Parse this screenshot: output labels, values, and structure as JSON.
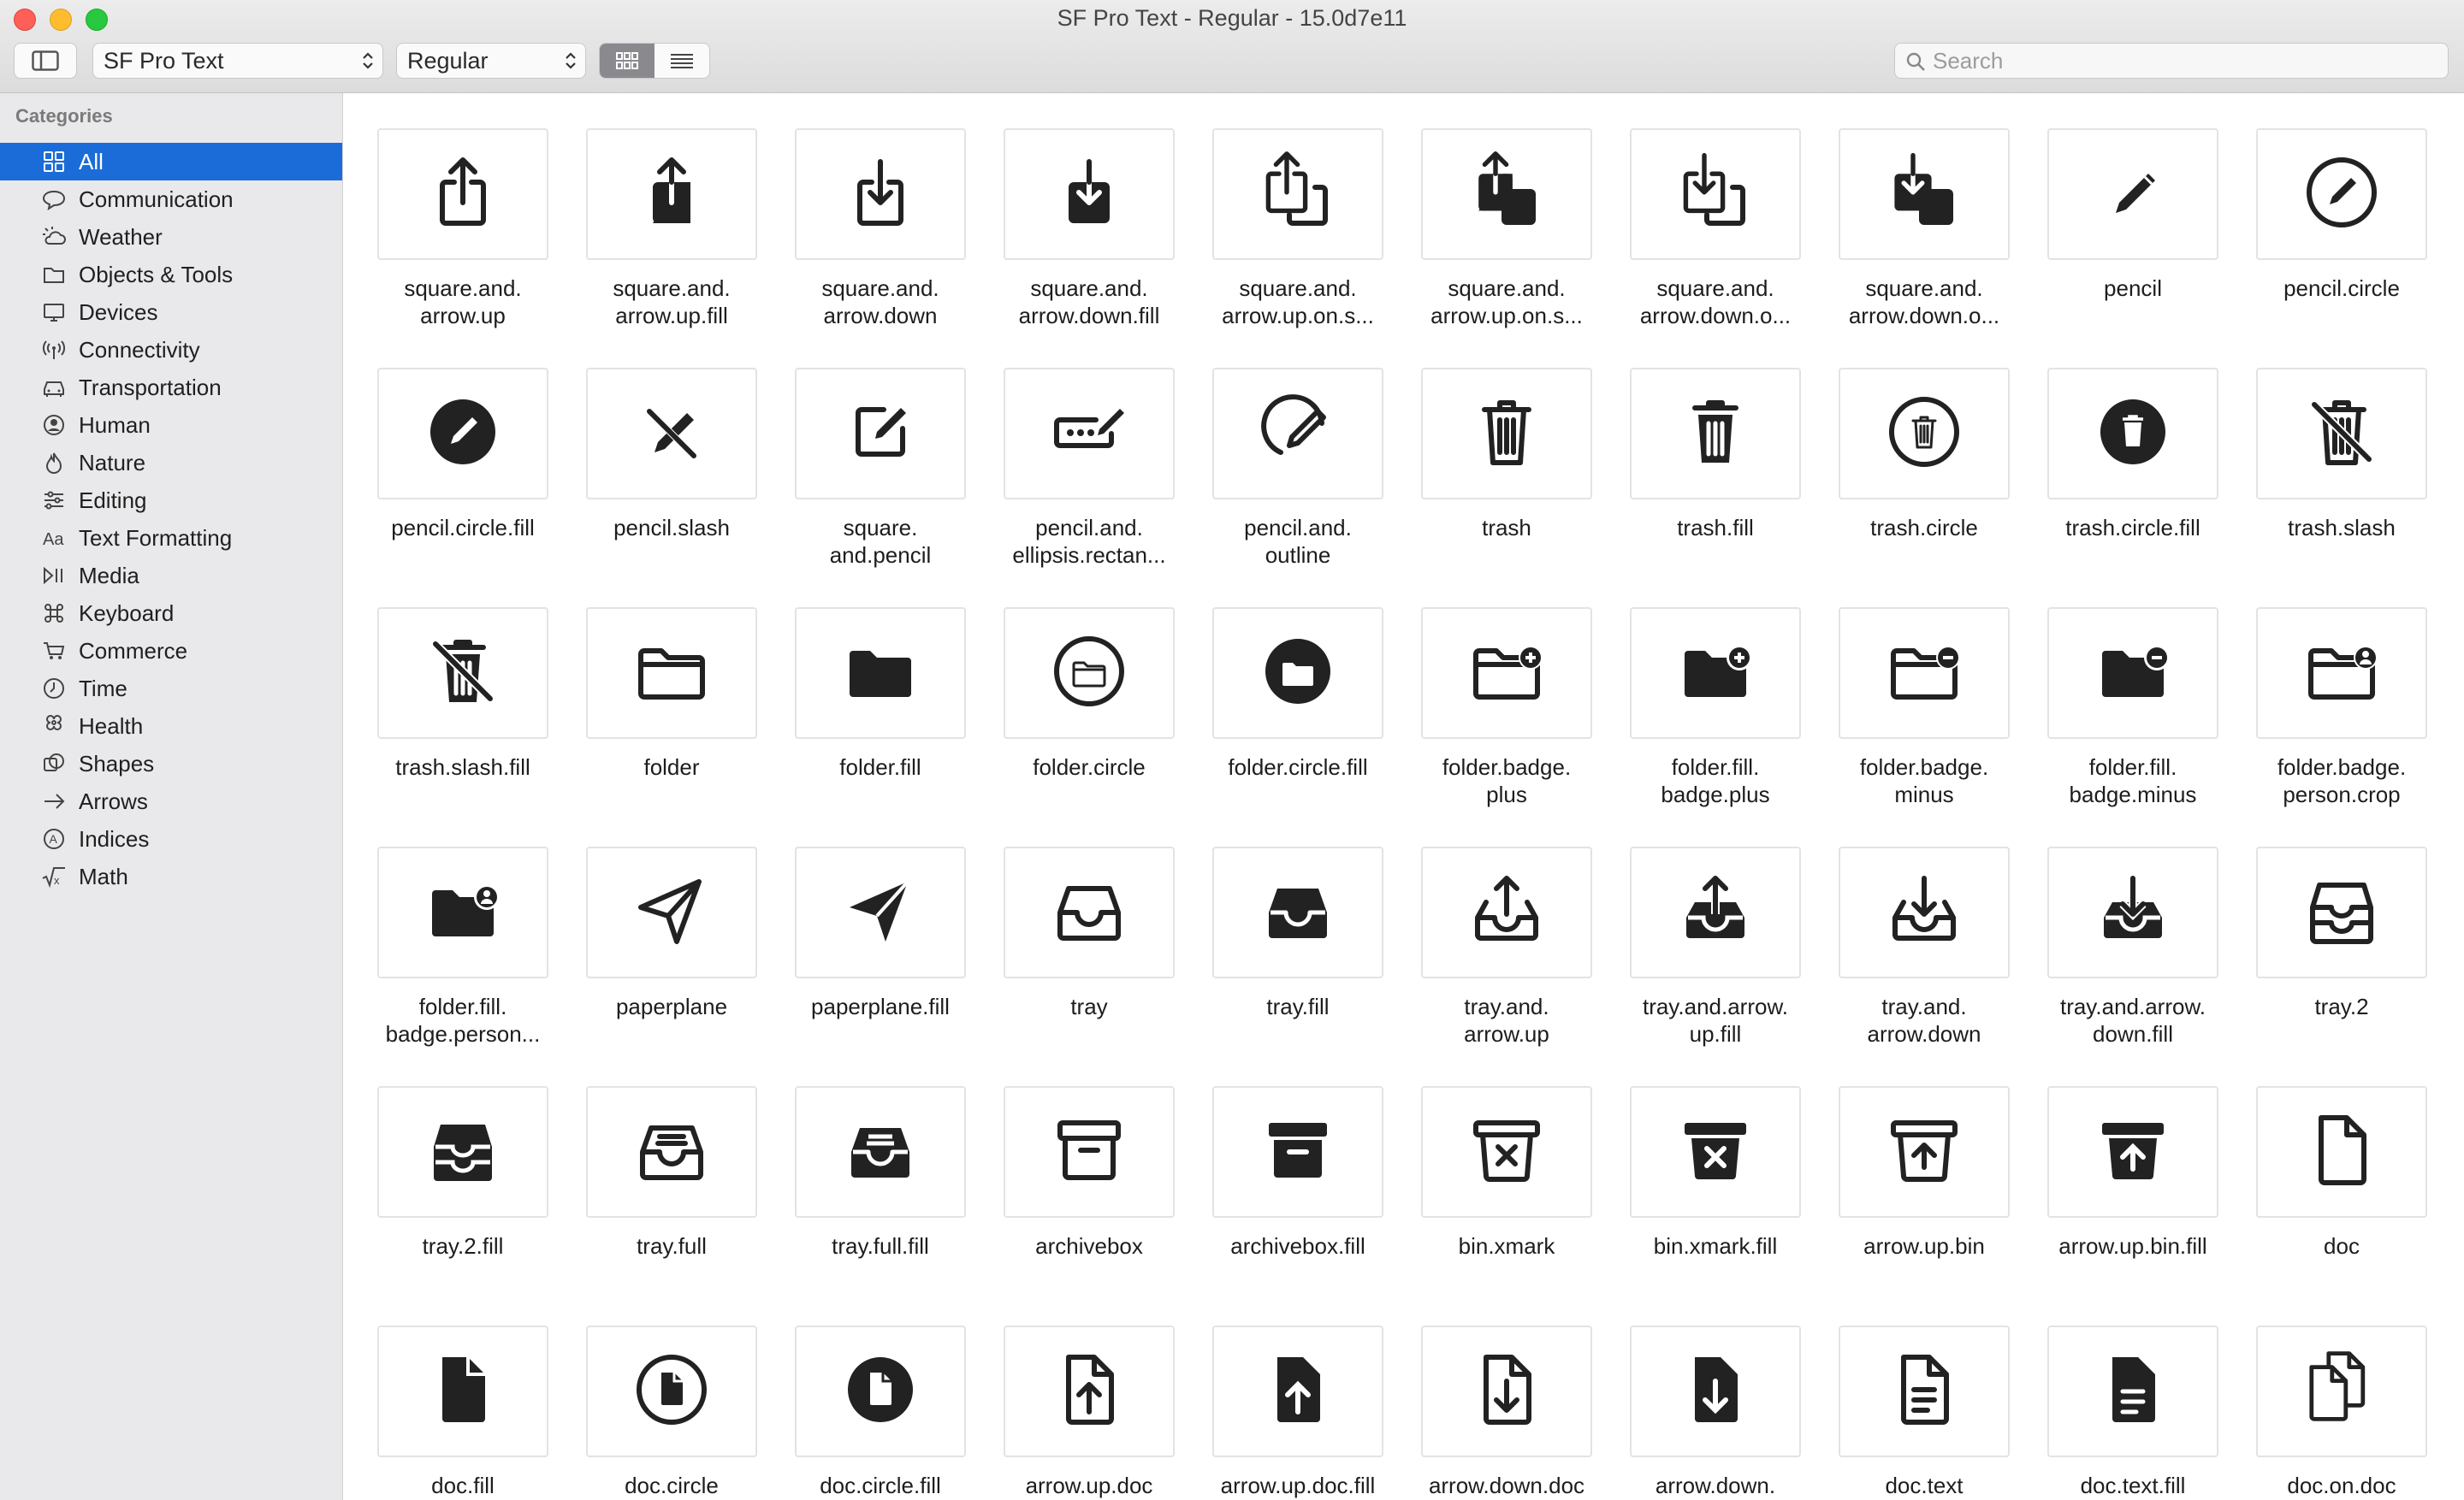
{
  "window": {
    "title": "SF Pro Text - Regular - 15.0d7e11"
  },
  "toolbar": {
    "font_value": "SF Pro Text",
    "weight_value": "Regular",
    "search_placeholder": "Search",
    "view_mode": "grid"
  },
  "sidebar": {
    "heading": "Categories",
    "items": [
      {
        "label": "All",
        "icon": "grid-icon",
        "active": true
      },
      {
        "label": "Communication",
        "icon": "speech-bubble-icon"
      },
      {
        "label": "Weather",
        "icon": "cloud-sun-icon"
      },
      {
        "label": "Objects & Tools",
        "icon": "folder-icon"
      },
      {
        "label": "Devices",
        "icon": "desktop-icon"
      },
      {
        "label": "Connectivity",
        "icon": "antenna-icon"
      },
      {
        "label": "Transportation",
        "icon": "car-icon"
      },
      {
        "label": "Human",
        "icon": "person-icon"
      },
      {
        "label": "Nature",
        "icon": "flame-icon"
      },
      {
        "label": "Editing",
        "icon": "sliders-icon"
      },
      {
        "label": "Text Formatting",
        "icon": "text-aa-icon"
      },
      {
        "label": "Media",
        "icon": "play-pause-icon"
      },
      {
        "label": "Keyboard",
        "icon": "command-icon"
      },
      {
        "label": "Commerce",
        "icon": "cart-icon"
      },
      {
        "label": "Time",
        "icon": "clock-icon"
      },
      {
        "label": "Health",
        "icon": "heart-icon"
      },
      {
        "label": "Shapes",
        "icon": "shapes-icon"
      },
      {
        "label": "Arrows",
        "icon": "arrow-right-icon"
      },
      {
        "label": "Indices",
        "icon": "circled-a-icon"
      },
      {
        "label": "Math",
        "icon": "sqrt-icon"
      }
    ]
  },
  "symbols": [
    {
      "name": "square.and.\narrow.up",
      "icon": "share-icon"
    },
    {
      "name": "square.and.\narrow.up.fill",
      "icon": "share-fill-icon"
    },
    {
      "name": "square.and.\narrow.down",
      "icon": "download-box-icon"
    },
    {
      "name": "square.and.\narrow.down.fill",
      "icon": "download-box-fill-icon"
    },
    {
      "name": "square.and.\narrow.up.on.s...",
      "icon": "share-stack-icon"
    },
    {
      "name": "square.and.\narrow.up.on.s...",
      "icon": "share-stack-fill-icon"
    },
    {
      "name": "square.and.\narrow.down.o...",
      "icon": "download-stack-icon"
    },
    {
      "name": "square.and.\narrow.down.o...",
      "icon": "download-stack-fill-icon"
    },
    {
      "name": "pencil",
      "icon": "pencil-icon"
    },
    {
      "name": "pencil.circle",
      "icon": "pencil-circle-icon"
    },
    {
      "name": "pencil.circle.fill",
      "icon": "pencil-circle-fill-icon"
    },
    {
      "name": "pencil.slash",
      "icon": "pencil-slash-icon"
    },
    {
      "name": "square.\nand.pencil",
      "icon": "compose-icon"
    },
    {
      "name": "pencil.and.\nellipsis.rectan...",
      "icon": "pencil-ellipsis-icon"
    },
    {
      "name": "pencil.and.\noutline",
      "icon": "pencil-outline-icon"
    },
    {
      "name": "trash",
      "icon": "trash-icon"
    },
    {
      "name": "trash.fill",
      "icon": "trash-fill-icon"
    },
    {
      "name": "trash.circle",
      "icon": "trash-circle-icon"
    },
    {
      "name": "trash.circle.fill",
      "icon": "trash-circle-fill-icon"
    },
    {
      "name": "trash.slash",
      "icon": "trash-slash-icon"
    },
    {
      "name": "trash.slash.fill",
      "icon": "trash-slash-fill-icon"
    },
    {
      "name": "folder",
      "icon": "folder-icon"
    },
    {
      "name": "folder.fill",
      "icon": "folder-fill-icon"
    },
    {
      "name": "folder.circle",
      "icon": "folder-circle-icon"
    },
    {
      "name": "folder.circle.fill",
      "icon": "folder-circle-fill-icon"
    },
    {
      "name": "folder.badge.\nplus",
      "icon": "folder-plus-icon"
    },
    {
      "name": "folder.fill.\nbadge.plus",
      "icon": "folder-fill-plus-icon"
    },
    {
      "name": "folder.badge.\nminus",
      "icon": "folder-minus-icon"
    },
    {
      "name": "folder.fill.\nbadge.minus",
      "icon": "folder-fill-minus-icon"
    },
    {
      "name": "folder.badge.\nperson.crop",
      "icon": "folder-person-icon"
    },
    {
      "name": "folder.fill.\nbadge.person...",
      "icon": "folder-fill-person-icon"
    },
    {
      "name": "paperplane",
      "icon": "paperplane-icon"
    },
    {
      "name": "paperplane.fill",
      "icon": "paperplane-fill-icon"
    },
    {
      "name": "tray",
      "icon": "tray-icon"
    },
    {
      "name": "tray.fill",
      "icon": "tray-fill-icon"
    },
    {
      "name": "tray.and.\narrow.up",
      "icon": "tray-arrow-up-icon"
    },
    {
      "name": "tray.and.arrow.\nup.fill",
      "icon": "tray-arrow-up-fill-icon"
    },
    {
      "name": "tray.and.\narrow.down",
      "icon": "tray-arrow-down-icon"
    },
    {
      "name": "tray.and.arrow.\ndown.fill",
      "icon": "tray-arrow-down-fill-icon"
    },
    {
      "name": "tray.2",
      "icon": "tray2-icon"
    },
    {
      "name": "tray.2.fill",
      "icon": "tray2-fill-icon"
    },
    {
      "name": "tray.full",
      "icon": "tray-full-icon"
    },
    {
      "name": "tray.full.fill",
      "icon": "tray-full-fill-icon"
    },
    {
      "name": "archivebox",
      "icon": "archivebox-icon"
    },
    {
      "name": "archivebox.fill",
      "icon": "archivebox-fill-icon"
    },
    {
      "name": "bin.xmark",
      "icon": "bin-xmark-icon"
    },
    {
      "name": "bin.xmark.fill",
      "icon": "bin-xmark-fill-icon"
    },
    {
      "name": "arrow.up.bin",
      "icon": "arrow-up-bin-icon"
    },
    {
      "name": "arrow.up.bin.fill",
      "icon": "arrow-up-bin-fill-icon"
    },
    {
      "name": "doc",
      "icon": "doc-icon"
    },
    {
      "name": "doc.fill",
      "icon": "doc-fill-icon"
    },
    {
      "name": "doc.circle",
      "icon": "doc-circle-icon"
    },
    {
      "name": "doc.circle.fill",
      "icon": "doc-circle-fill-icon"
    },
    {
      "name": "arrow.up.doc",
      "icon": "arrow-up-doc-icon"
    },
    {
      "name": "arrow.up.doc.fill",
      "icon": "arrow-up-doc-fill-icon"
    },
    {
      "name": "arrow.down.doc",
      "icon": "arrow-down-doc-icon"
    },
    {
      "name": "arrow.down.",
      "icon": "arrow-down-doc-fill-icon"
    },
    {
      "name": "doc.text",
      "icon": "doc-text-icon"
    },
    {
      "name": "doc.text.fill",
      "icon": "doc-text-fill-icon"
    },
    {
      "name": "doc.on.doc",
      "icon": "doc-on-doc-icon"
    }
  ]
}
